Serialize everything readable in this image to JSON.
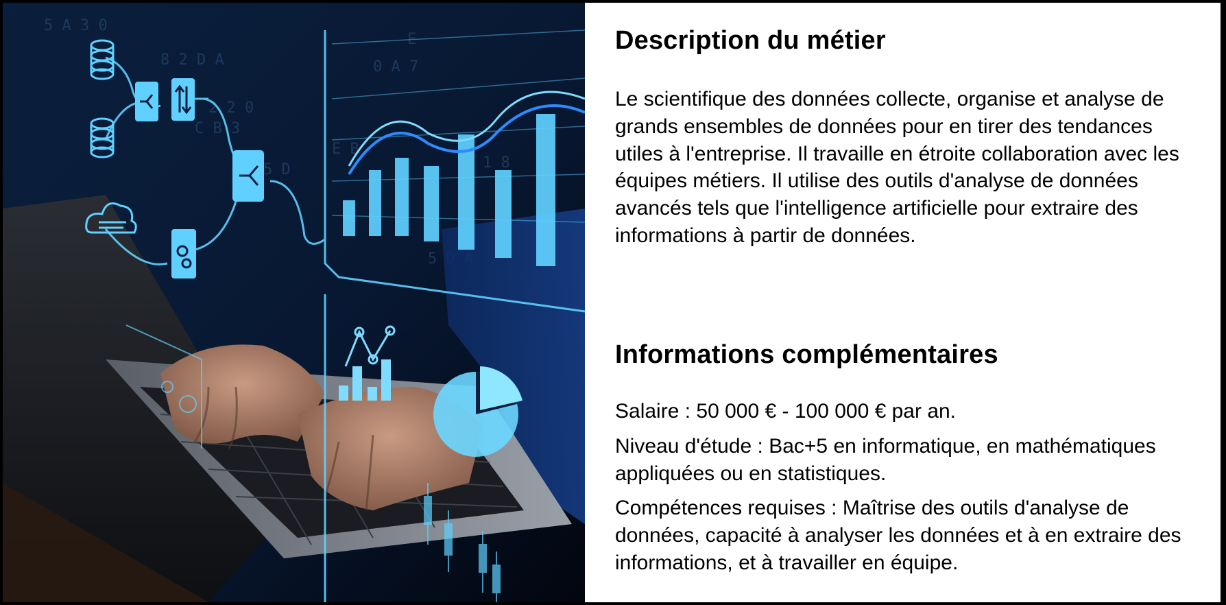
{
  "hero_image": {
    "alt": "",
    "icons": [
      "database-icon",
      "database-icon",
      "cloud-icon",
      "merge-icon",
      "sort-arrows-icon",
      "merge-icon",
      "gears-icon",
      "bar-chart-icon",
      "pie-chart-icon",
      "line-chart-icon"
    ],
    "accent_color": "#5fd0ff"
  },
  "description": {
    "title": "Description du métier",
    "text": "Le scientifique des données collecte, organise et analyse de grands ensembles de données pour en tirer des tendances utiles à l'entreprise. Il travaille en étroite collaboration avec les équipes métiers. Il utilise des outils d'analyse de données avancés tels que l'intelligence artificielle pour extraire des informations à partir de données."
  },
  "info": {
    "title": "Informations complémentaires",
    "salary": "Salaire : 50 000 € - 100 000 € par an.",
    "education": "Niveau d'étude : Bac+5 en informatique, en mathématiques appliquées ou en statistiques.",
    "skills": "Compétences requises : Maîtrise des outils d'analyse de données, capacité à analyser les données et à en extraire des informations, et à travailler en équipe."
  }
}
